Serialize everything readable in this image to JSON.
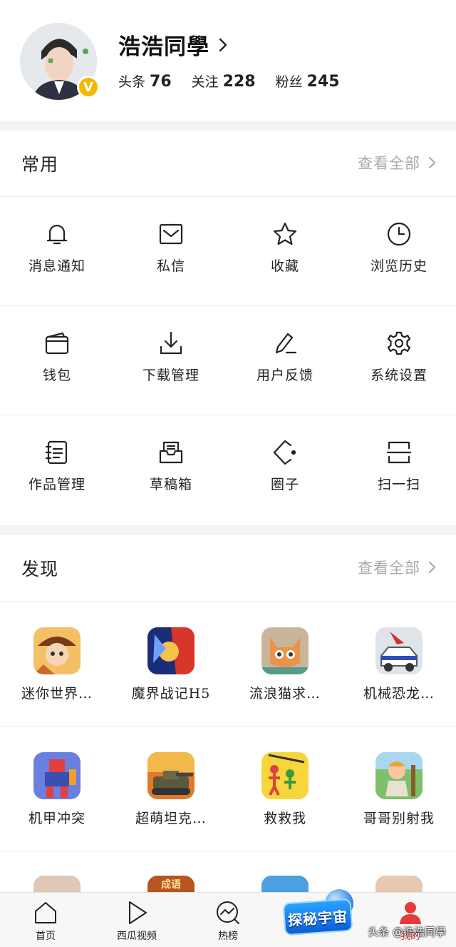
{
  "profile": {
    "name": "浩浩同學",
    "badge": "V",
    "stats": [
      {
        "label": "头条",
        "value": "76"
      },
      {
        "label": "关注",
        "value": "228"
      },
      {
        "label": "粉丝",
        "value": "245"
      }
    ]
  },
  "common": {
    "title": "常用",
    "more": "查看全部",
    "items": [
      {
        "label": "消息通知",
        "icon": "bell-icon"
      },
      {
        "label": "私信",
        "icon": "mail-icon"
      },
      {
        "label": "收藏",
        "icon": "star-icon"
      },
      {
        "label": "浏览历史",
        "icon": "clock-icon"
      },
      {
        "label": "钱包",
        "icon": "wallet-icon"
      },
      {
        "label": "下载管理",
        "icon": "download-icon"
      },
      {
        "label": "用户反馈",
        "icon": "pen-icon"
      },
      {
        "label": "系统设置",
        "icon": "gear-icon"
      },
      {
        "label": "作品管理",
        "icon": "notebook-icon"
      },
      {
        "label": "草稿箱",
        "icon": "draft-box-icon"
      },
      {
        "label": "圈子",
        "icon": "circle-icon"
      },
      {
        "label": "扫一扫",
        "icon": "scan-icon"
      }
    ]
  },
  "discover": {
    "title": "发现",
    "more": "查看全部",
    "apps": [
      {
        "label": "迷你世界…",
        "color": "#c96a2a"
      },
      {
        "label": "魔界战记H5",
        "color": "#2a4fb8"
      },
      {
        "label": "流浪猫求…",
        "color": "#d9a26a"
      },
      {
        "label": "机械恐龙…",
        "color": "#9aa6b4"
      },
      {
        "label": "机甲冲突",
        "color": "#5a6fd8"
      },
      {
        "label": "超萌坦克…",
        "color": "#8a5a2a"
      },
      {
        "label": "救救我",
        "color": "#f4d23a"
      },
      {
        "label": "哥哥别射我",
        "color": "#6fb85a"
      }
    ],
    "partial_colors": [
      "#e0c8b8",
      "#b8551f",
      "#4aa0e0",
      "#e8c8b0"
    ],
    "partial_text": "成语"
  },
  "tabbar": {
    "tabs": [
      {
        "label": "首页",
        "icon": "home-icon"
      },
      {
        "label": "西瓜视频",
        "icon": "play-icon"
      },
      {
        "label": "热榜",
        "icon": "trending-icon"
      },
      {
        "label": "",
        "icon": "promo"
      },
      {
        "label": "我的",
        "icon": "user-icon"
      }
    ],
    "promo_text": "探秘宇宙",
    "watermark": "头条 @浩浩同學"
  },
  "colors": {
    "accent": "#e23b3b",
    "badge": "#f5b800",
    "muted": "#a8a8a8"
  }
}
